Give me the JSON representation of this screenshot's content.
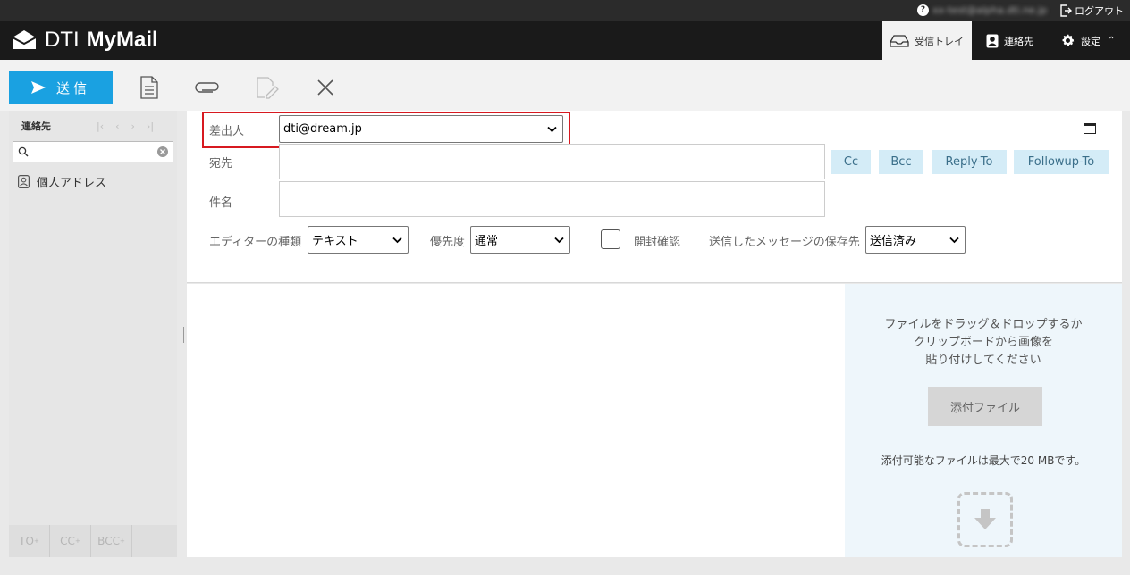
{
  "topbar": {
    "account": "xx-test@alpha.dti.ne.jp",
    "logout_label": "ログアウト"
  },
  "header": {
    "brand_light": "DTI",
    "brand_bold": "MyMail",
    "nav": {
      "inbox": "受信トレイ",
      "contacts": "連絡先",
      "settings": "設定"
    }
  },
  "toolbar": {
    "send_label": "送信"
  },
  "sidebar": {
    "title": "連絡先",
    "search_placeholder": "",
    "address_book": "個人アドレス",
    "recipient_buttons": [
      "TO",
      "CC",
      "BCC"
    ]
  },
  "compose": {
    "from_label": "差出人",
    "from_value": "dti@dream.jp",
    "to_label": "宛先",
    "to_value": "",
    "subject_label": "件名",
    "subject_value": "",
    "cc_label": "Cc",
    "bcc_label": "Bcc",
    "reply_to_label": "Reply-To",
    "followup_to_label": "Followup-To",
    "editor_label": "エディターの種類",
    "editor_value": "テキスト",
    "priority_label": "優先度",
    "priority_value": "通常",
    "read_receipt_label": "開封確認",
    "save_sent_label": "送信したメッセージの保存先",
    "save_sent_value": "送信済み"
  },
  "attachments": {
    "drop_message_line1": "ファイルをドラッグ＆ドロップするか",
    "drop_message_line2": "クリップボードから画像を",
    "drop_message_line3": "貼り付けしてください",
    "attach_button": "添付ファイル",
    "size_limit": "添付可能なファイルは最大で20 MBです。"
  },
  "colors": {
    "accent": "#1aa1e1",
    "header_bg": "#1a1a1a",
    "highlight": "#d71920",
    "tag_button_bg": "#d4ecf7"
  }
}
